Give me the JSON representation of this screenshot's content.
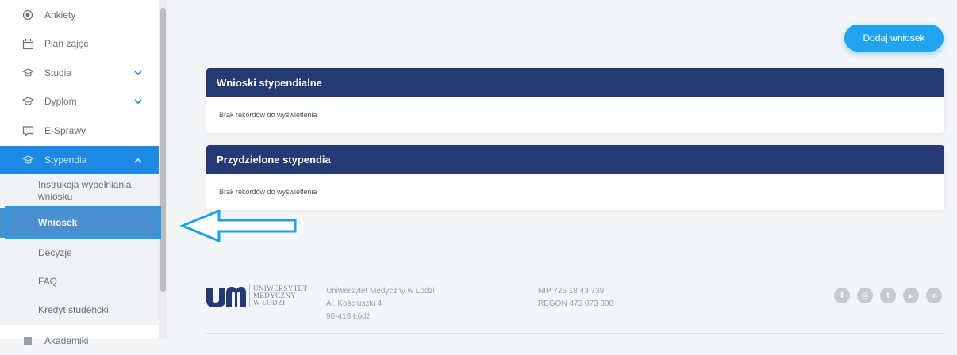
{
  "sidebar": {
    "items": [
      {
        "label": "Ankiety",
        "icon": "radio-icon"
      },
      {
        "label": "Plan zajęć",
        "icon": "calendar-icon"
      },
      {
        "label": "Studia",
        "icon": "graduation-cap-icon"
      },
      {
        "label": "Dyplom",
        "icon": "graduation-cap-icon"
      },
      {
        "label": "E-Sprawy",
        "icon": "comment-icon"
      },
      {
        "label": "Stypendia",
        "icon": "graduation-cap-icon"
      },
      {
        "label": "Akademiki",
        "icon": "building-icon"
      }
    ],
    "sub_items": [
      {
        "label": "Instrukcja wypełniania wniosku"
      },
      {
        "label": "Wniosek"
      },
      {
        "label": "Decyzje"
      },
      {
        "label": "FAQ"
      },
      {
        "label": "Kredyt studencki"
      }
    ]
  },
  "main": {
    "add_button": "Dodaj wniosek",
    "panels": [
      {
        "title": "Wnioski stypendialne",
        "empty": "Brak rekordów do wyświetlenia"
      },
      {
        "title": "Przydzielone stypendia",
        "empty": "Brak rekordów do wyświetlenia"
      }
    ]
  },
  "footer": {
    "logo_lines": [
      "UNIWERSYTET",
      "MEDYCZNY",
      "W ŁODZI"
    ],
    "address": [
      "Uniwersytet Medyczny w Łodzi",
      "Al. Kościuszki 4",
      "90-419 Łódź"
    ],
    "ids": [
      "NIP 725 18 43 739",
      "REGON 473 073 308"
    ],
    "socials": [
      "f",
      "◎",
      "t",
      "▶",
      "in"
    ]
  },
  "colors": {
    "accent": "#1e88e5",
    "panel_header": "#253a73",
    "button": "#20a4ef",
    "highlight": "#1da1e8"
  }
}
